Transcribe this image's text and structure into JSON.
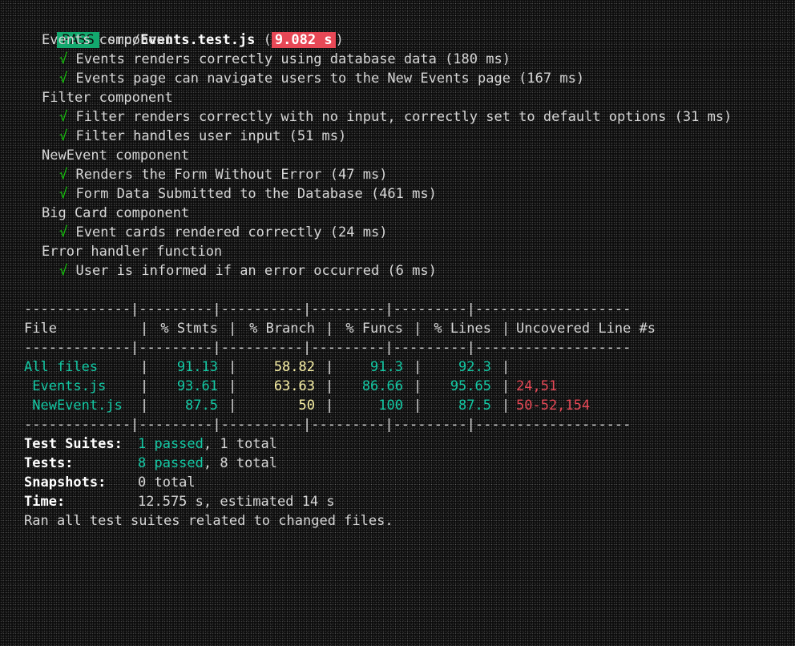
{
  "header": {
    "pass_label": "PASS",
    "file_dir": "src/",
    "file_name": "Events.test.js",
    "open_paren": "(",
    "duration": "9.082 s",
    "close_paren": ")"
  },
  "suites": [
    {
      "name": "Events component",
      "tests": [
        "Events renders correctly using database data (180 ms)",
        "Events page can navigate users to the New Events page (167 ms)"
      ]
    },
    {
      "name": "Filter component",
      "tests": [
        "Filter renders correctly with no input, correctly set to default options (31 ms)",
        "Filter handles user input (51 ms)"
      ]
    },
    {
      "name": "NewEvent component",
      "tests": [
        "Renders the Form Without Error (47 ms)",
        "Form Data Submitted to the Database (461 ms)"
      ]
    },
    {
      "name": "Big Card component",
      "tests": [
        "Event cards rendered correctly (24 ms)"
      ]
    },
    {
      "name": "Error handler function",
      "tests": [
        "User is informed if an error occurred (6 ms)"
      ]
    }
  ],
  "check_mark": "√",
  "coverage": {
    "separator": "-------------|---------|----------|---------|---------|-------------------",
    "headers": [
      "File",
      "% Stmts",
      "% Branch",
      "% Funcs",
      "% Lines",
      "Uncovered Line #s"
    ],
    "rows": [
      {
        "file": "All files",
        "stmts": "91.13",
        "branch": "58.82",
        "funcs": "91.3",
        "lines": "92.3",
        "uncovered": ""
      },
      {
        "file": " Events.js",
        "stmts": "93.61",
        "branch": "63.63",
        "funcs": "86.66",
        "lines": "95.65",
        "uncovered": "24,51"
      },
      {
        "file": " NewEvent.js",
        "stmts": "87.5",
        "branch": "50",
        "funcs": "100",
        "lines": "87.5",
        "uncovered": "50-52,154"
      }
    ],
    "pipe": "|",
    "colors": {
      "good": "#13c9a4",
      "medium": "#f9f1a5",
      "bad": "#e74856"
    }
  },
  "summary": {
    "suites_label": "Test Suites:",
    "suites_passed": "1 passed",
    "suites_rest": ", 1 total",
    "tests_label": "Tests:",
    "tests_passed": "8 passed",
    "tests_rest": ", 8 total",
    "snapshots_label": "Snapshots:",
    "snapshots_value": "0 total",
    "time_label": "Time:",
    "time_value": "12.575 s, estimated 14 s",
    "footer": "Ran all test suites related to changed files."
  }
}
